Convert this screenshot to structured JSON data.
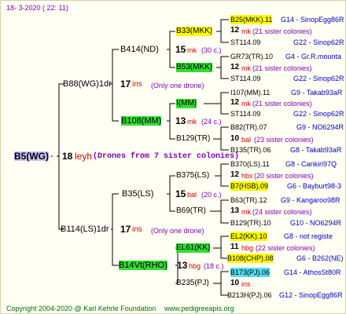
{
  "header": {
    "date": "18-  3-2020 ( 22: 11)"
  },
  "root": {
    "name": "B5(WG)",
    "dash": "-",
    "gen_num": "18",
    "gen_text": "leyh",
    "note": "(Drones from 7 sister colonies)"
  },
  "gen1": [
    {
      "name": "B88(WG)1dr",
      "num": "17",
      "abbr": "ins",
      "note": "(Only one drone)"
    },
    {
      "name": "B114(LS)1dr",
      "num": "17",
      "abbr": "ins",
      "note": "(Only one drone)"
    }
  ],
  "gen2": [
    {
      "name": "B414(ND)",
      "num": "15",
      "abbr": "mk",
      "note": "(30 c.)"
    },
    {
      "name": "B108(MM)",
      "num": "13",
      "abbr": "mk",
      "note": "(24 c.)"
    },
    {
      "name": "B35(LS)",
      "num": "15",
      "abbr": "bal",
      "note": "(20 c.)"
    },
    {
      "name": "B14Vt(RHO)",
      "num": "13",
      "abbr": "hbg",
      "note": "(18 c.)"
    }
  ],
  "gen3": [
    {
      "name": "B33(MKK)"
    },
    {
      "name": "B53(MKK)"
    },
    {
      "name": "I(MM)"
    },
    {
      "name": "B129(TR)"
    },
    {
      "name": "B375(LS)"
    },
    {
      "name": "B69(TR)"
    },
    {
      "name": "EL61(KK)"
    },
    {
      "name": "B235(PJ)"
    }
  ],
  "gen4": [
    {
      "top": "B25(MKK).11",
      "top_src": "G14 - SinopEgg86R",
      "num": "12",
      "abbr": "mk",
      "note": "(21 sister colonies)",
      "bottom": "ST114.09",
      "bottom_src": "G22 - Sinop62R"
    },
    {
      "top": "GR73(TR).10",
      "top_src": "G4 - Gr.R.mounta",
      "num": "12",
      "abbr": "mk",
      "note": "(21 sister colonies)",
      "bottom": "ST114.09",
      "bottom_src": "G22 - Sinop62R"
    },
    {
      "top": "I107(MM).11",
      "top_src": "G9 - Takab93aR",
      "num": "12",
      "abbr": "mk",
      "note": "(21 sister colonies)",
      "bottom": "ST114.09",
      "bottom_src": "G22 - Sinop62R"
    },
    {
      "top": "B82(TR).07",
      "top_src": "G9 - NO6294R",
      "num": "10",
      "abbr": "bal",
      "note": "(23 sister colonies)",
      "bottom": "B135(TR).06",
      "bottom_src": "G8 - Takab93aR"
    },
    {
      "top": "B370(LS).11",
      "top_src": "G8 - Cankiri97Q",
      "num": "12",
      "abbr": "hbx",
      "note": "(20 sister colonies)",
      "bottom": "B7(HSB).09",
      "bottom_src": "G6 - Bayburt98-3"
    },
    {
      "top": "B63(TR).12",
      "top_src": "G9 - Kangaroo98R",
      "num": "13",
      "abbr": "mk",
      "note": "(24 sister colonies)",
      "bottom": "B129(TR).10",
      "bottom_src": "G10 - NO6294R"
    },
    {
      "top": "EL2(KK).10",
      "top_src": "G8 - not registe",
      "num": "11",
      "abbr": "hbg",
      "note": "(22 sister colonies)",
      "bottom": "B108(CHP).08",
      "bottom_src": "G6 - B262(NE)"
    },
    {
      "top": "B173(PJ).06",
      "top_src": "G14 - AthosSt80R",
      "num": "10",
      "abbr": "ins",
      "note": "",
      "bottom": "B213H(PJ).06",
      "bottom_src": "G12 - SinopEgg86R"
    }
  ],
  "footer": {
    "copyright": "Copyright 2004-2020 @ Karl Kehrle Foundation",
    "url": "www.pedigreeapis.org"
  },
  "colors": {
    "yellow": "#ffff00",
    "green": "#33dd33",
    "cyan": "#55ddee",
    "line": "#000000",
    "red": "#d00000",
    "blue": "#0000c0"
  }
}
